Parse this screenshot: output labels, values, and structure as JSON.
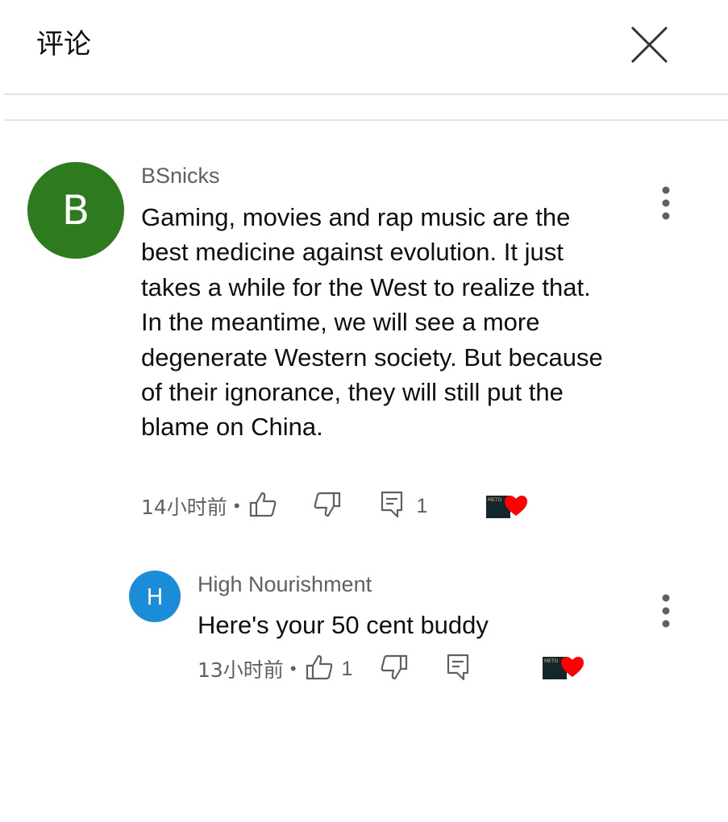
{
  "header": {
    "title": "评论"
  },
  "comments": [
    {
      "author": "BSnicks",
      "avatar_letter": "B",
      "avatar_color": "#2d7a1f",
      "text": "Gaming, movies and rap music are the best medicine against evolution. It just takes a while for the West to realize that. In the meantime, we will see a more degenerate Western society. But because of their ignorance, they will still put the blame on China.",
      "time": "14小时前",
      "like_count": "",
      "reply_count": "1",
      "creator_heart": "METO"
    },
    {
      "author": "High Nourishment",
      "avatar_letter": "H",
      "avatar_color": "#1a8cd8",
      "text": "Here's your 50 cent buddy",
      "time": "13小时前",
      "like_count": "1",
      "reply_count": "",
      "creator_heart": "METO"
    }
  ],
  "colors": {
    "heart": "#ff0000",
    "secondary_text": "#606060"
  }
}
